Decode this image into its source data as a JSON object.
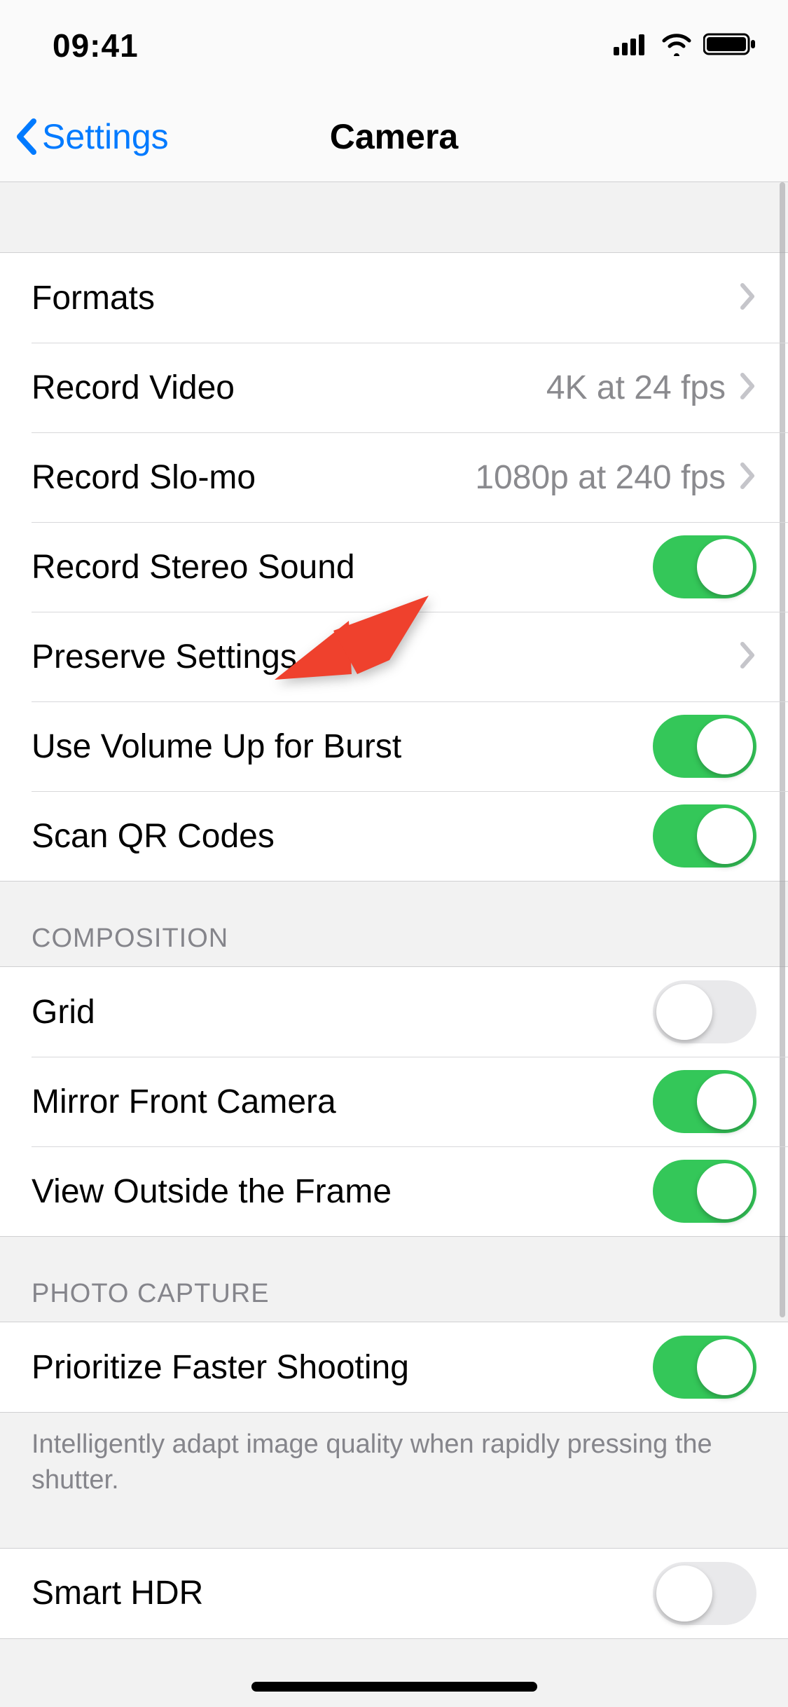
{
  "status": {
    "time": "09:41"
  },
  "nav": {
    "back": "Settings",
    "title": "Camera"
  },
  "sections": {
    "main": [
      {
        "label": "Formats",
        "type": "navigate"
      },
      {
        "label": "Record Video",
        "value": "4K at 24 fps",
        "type": "navigate"
      },
      {
        "label": "Record Slo-mo",
        "value": "1080p at 240 fps",
        "type": "navigate"
      },
      {
        "label": "Record Stereo Sound",
        "type": "toggle",
        "on": true
      },
      {
        "label": "Preserve Settings",
        "type": "navigate"
      },
      {
        "label": "Use Volume Up for Burst",
        "type": "toggle",
        "on": true
      },
      {
        "label": "Scan QR Codes",
        "type": "toggle",
        "on": true
      }
    ],
    "composition": {
      "header": "COMPOSITION",
      "rows": [
        {
          "label": "Grid",
          "type": "toggle",
          "on": false
        },
        {
          "label": "Mirror Front Camera",
          "type": "toggle",
          "on": true
        },
        {
          "label": "View Outside the Frame",
          "type": "toggle",
          "on": true
        }
      ]
    },
    "photo_capture": {
      "header": "PHOTO CAPTURE",
      "rows": [
        {
          "label": "Prioritize Faster Shooting",
          "type": "toggle",
          "on": true
        }
      ],
      "footer": "Intelligently adapt image quality when rapidly pressing the shutter."
    },
    "smart_hdr": {
      "rows": [
        {
          "label": "Smart HDR",
          "type": "toggle",
          "on": false
        }
      ]
    }
  }
}
